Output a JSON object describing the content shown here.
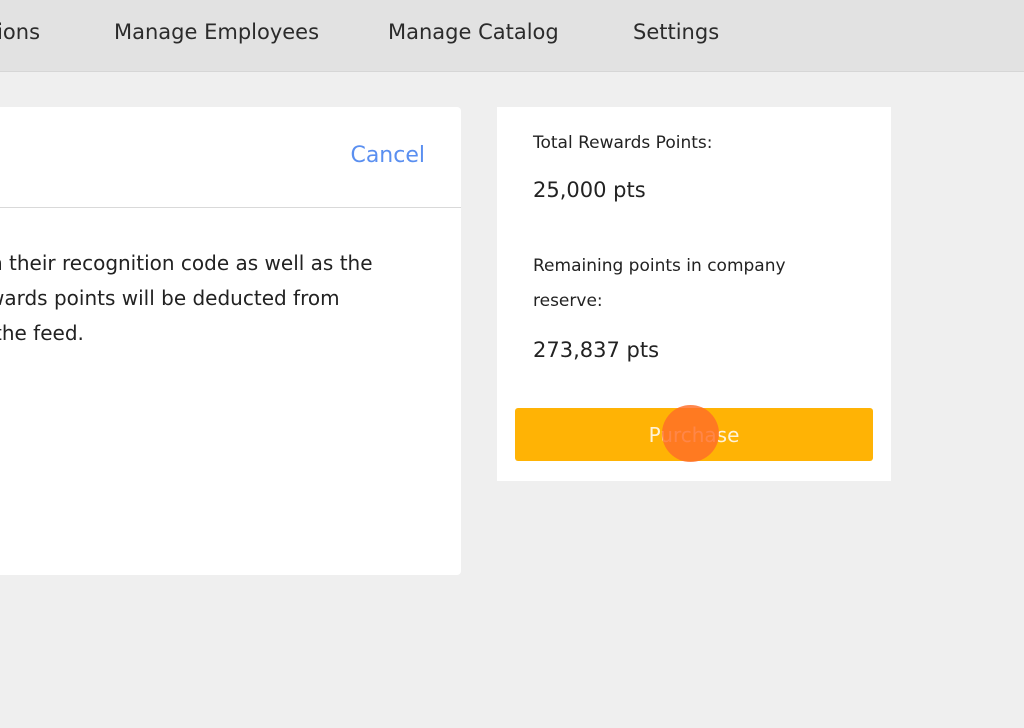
{
  "nav": {
    "items": [
      {
        "label": "ations"
      },
      {
        "label": "Manage Employees"
      },
      {
        "label": "Manage Catalog"
      },
      {
        "label": "Settings"
      }
    ]
  },
  "left_panel": {
    "cancel_label": "Cancel",
    "description_lines": [
      "h their recognition code as well as the",
      "wards points will be deducted from",
      "the feed."
    ]
  },
  "summary": {
    "total_label": "Total Rewards Points:",
    "total_value": "25,000 pts",
    "remaining_label_line1": "Remaining points in company",
    "remaining_label_line2": "reserve:",
    "remaining_value": "273,837 pts",
    "purchase_label": "Purchase"
  },
  "colors": {
    "accent_button": "#ffb305",
    "link": "#5a8ff0",
    "click_indicator": "#ff6e28"
  }
}
